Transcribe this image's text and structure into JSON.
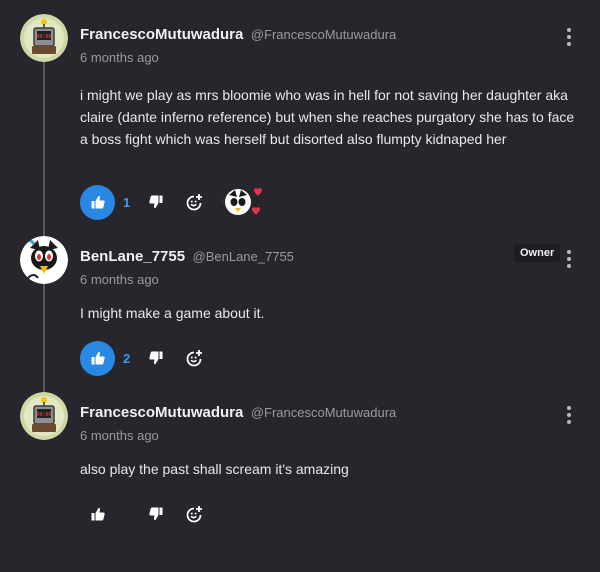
{
  "comments": [
    {
      "author": "FrancescoMutuwadura",
      "handle": "@FrancescoMutuwadura",
      "time": "6 months ago",
      "text": "i might we play as mrs bloomie who was in hell for not saving her daughter aka claire (dante inferno reference) but when she reaches purgatory she has to face a boss fight which was herself but disorted also flumpty kidnaped her",
      "likes": "1",
      "liked": true,
      "avatar": "robot-avatar",
      "has_reaction": true
    },
    {
      "author": "BenLane_7755",
      "handle": "@BenLane_7755",
      "time": "6 months ago",
      "badge": "Owner",
      "text": "I might make a game about it.",
      "likes": "2",
      "liked": true,
      "avatar": "cartoon-bird-avatar"
    },
    {
      "author": "FrancescoMutuwadura",
      "handle": "@FrancescoMutuwadura",
      "time": "6 months ago",
      "text": "also play the past shall scream it's amazing",
      "likes": "",
      "liked": false,
      "avatar": "robot-avatar"
    }
  ],
  "icons": {
    "like": "thumbs-up-icon",
    "dislike": "thumbs-down-icon",
    "react": "add-reaction-icon",
    "more": "more-vertical-icon",
    "reaction": "creator-heart-icon"
  },
  "colors": {
    "background": "#28262d",
    "accent": "#2a88e5",
    "like_count": "#3b9cf2",
    "heart": "#e8324f",
    "muted": "#9a98a1"
  }
}
